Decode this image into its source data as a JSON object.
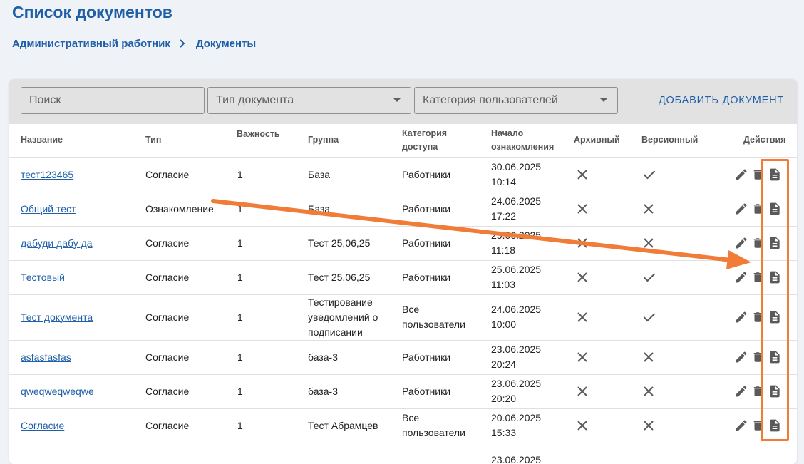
{
  "header": {
    "title": "Список документов",
    "breadcrumb": [
      "Административный работник",
      "Документы"
    ]
  },
  "toolbar": {
    "search_placeholder": "Поиск",
    "doc_type_label": "Тип документа",
    "user_category_label": "Категория пользователей",
    "add_button": "ДОБАВИТЬ ДОКУМЕНТ"
  },
  "table": {
    "headers": {
      "name": "Название",
      "type": "Тип",
      "importance": "Важность",
      "group": "Группа",
      "access_cat_1": "Категория",
      "access_cat_2": "доступа",
      "start_1": "Начало",
      "start_2": "ознакомления",
      "archived": "Архивный",
      "versioned": "Версионный",
      "actions": "Действия"
    },
    "rows": [
      {
        "name": "тест123465",
        "type": "Согласие",
        "importance": "1",
        "group": [
          "База"
        ],
        "access": [
          "Работники"
        ],
        "date": "30.06.2025",
        "time": "10:14",
        "archived": false,
        "versioned": true
      },
      {
        "name": "Общий тест",
        "type": "Ознакомление",
        "importance": "1",
        "group": [
          "База"
        ],
        "access": [
          "Работники"
        ],
        "date": "24.06.2025",
        "time": "17:22",
        "archived": false,
        "versioned": false
      },
      {
        "name": "дабуди дабу да",
        "type": "Согласие",
        "importance": "1",
        "group": [
          "Тест 25,06,25"
        ],
        "access": [
          "Работники"
        ],
        "date": "25.06.2025",
        "time": "11:18",
        "archived": false,
        "versioned": false
      },
      {
        "name": "Тестовый",
        "type": "Согласие",
        "importance": "1",
        "group": [
          "Тест 25,06,25"
        ],
        "access": [
          "Работники"
        ],
        "date": "25.06.2025",
        "time": "11:03",
        "archived": false,
        "versioned": true
      },
      {
        "name": "Тест документа",
        "type": "Согласие",
        "importance": "1",
        "group": [
          "Тестирование",
          "уведомлений о",
          "подписании"
        ],
        "access": [
          "Все",
          "пользователи"
        ],
        "date": "24.06.2025",
        "time": "10:00",
        "archived": false,
        "versioned": true
      },
      {
        "name": "asfasfasfas",
        "type": "Согласие",
        "importance": "1",
        "group": [
          "база-3"
        ],
        "access": [
          "Работники"
        ],
        "date": "23.06.2025",
        "time": "20:24",
        "archived": false,
        "versioned": false
      },
      {
        "name": "qweqweqweqwe",
        "type": "Согласие",
        "importance": "1",
        "group": [
          "база-3"
        ],
        "access": [
          "Работники"
        ],
        "date": "23.06.2025",
        "time": "20:20",
        "archived": false,
        "versioned": false
      },
      {
        "name": "Согласие",
        "type": "Согласие",
        "importance": "1",
        "group": [
          "Тест Абрамцев"
        ],
        "access": [
          "Все",
          "пользователи"
        ],
        "date": "20.06.2025",
        "time": "15:33",
        "archived": false,
        "versioned": false
      },
      {
        "name": "",
        "type": "",
        "importance": "",
        "group": [
          ""
        ],
        "access": [
          ""
        ],
        "date": "23.06.2025",
        "time": "",
        "archived": null,
        "versioned": null
      }
    ]
  },
  "icons": {
    "breadcrumb_separator": "chevron-right-icon",
    "dropdown": "caret-down-icon",
    "false_value": "close-icon",
    "true_value": "check-icon",
    "edit": "edit-icon",
    "delete": "delete-icon",
    "document": "document-icon"
  },
  "colors": {
    "primary": "#1f5fa8",
    "annotation": "#f07c38"
  }
}
